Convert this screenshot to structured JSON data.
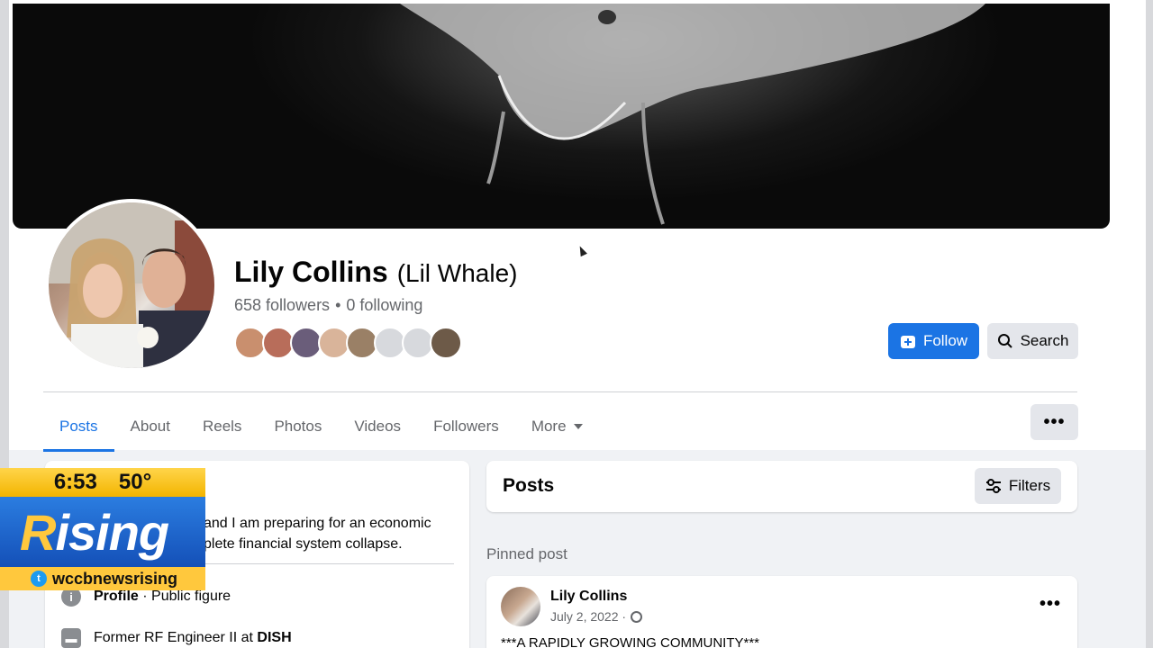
{
  "profile": {
    "name": "Lily Collins",
    "alt_name": "(Lil Whale)",
    "followers": "658 followers",
    "separator": "•",
    "following": "0 following",
    "friend_avatar_colors": [
      "#c98f6e",
      "#b86d5a",
      "#6a5d7a",
      "#d9b49a",
      "#9a8066",
      "#d7d9dd",
      "#d7d9dd",
      "#6d5a48"
    ]
  },
  "actions": {
    "follow_label": "Follow",
    "search_label": "Search",
    "more_label": "•••"
  },
  "tabs": [
    {
      "label": "Posts",
      "active": true
    },
    {
      "label": "About"
    },
    {
      "label": "Reels"
    },
    {
      "label": "Photos"
    },
    {
      "label": "Videos"
    },
    {
      "label": "Followers"
    },
    {
      "label": "More"
    }
  ],
  "intro": {
    "bio_line1": "and I am preparing for an economic",
    "bio_line2": "plete financial system collapse.",
    "profile_label": "Profile",
    "profile_value": "· Public figure",
    "work_prefix": "Former RF Engineer II at",
    "work_company": "DISH"
  },
  "posts_header": {
    "title": "Posts",
    "filters_label": "Filters"
  },
  "pinned": {
    "label": "Pinned post",
    "author": "Lily Collins",
    "date": "July 2, 2022 ·",
    "text": "***A RAPIDLY GROWING COMMUNITY***",
    "menu": "•••"
  },
  "tv_overlay": {
    "time": "6:53",
    "temp": "50°",
    "logo_r": "R",
    "logo_rest": "ising",
    "handle": "wccbnewsrising"
  },
  "colors": {
    "accent": "#1b74e4",
    "tv_yellow": "#ffc83d",
    "tv_blue": "#1f66cc"
  }
}
